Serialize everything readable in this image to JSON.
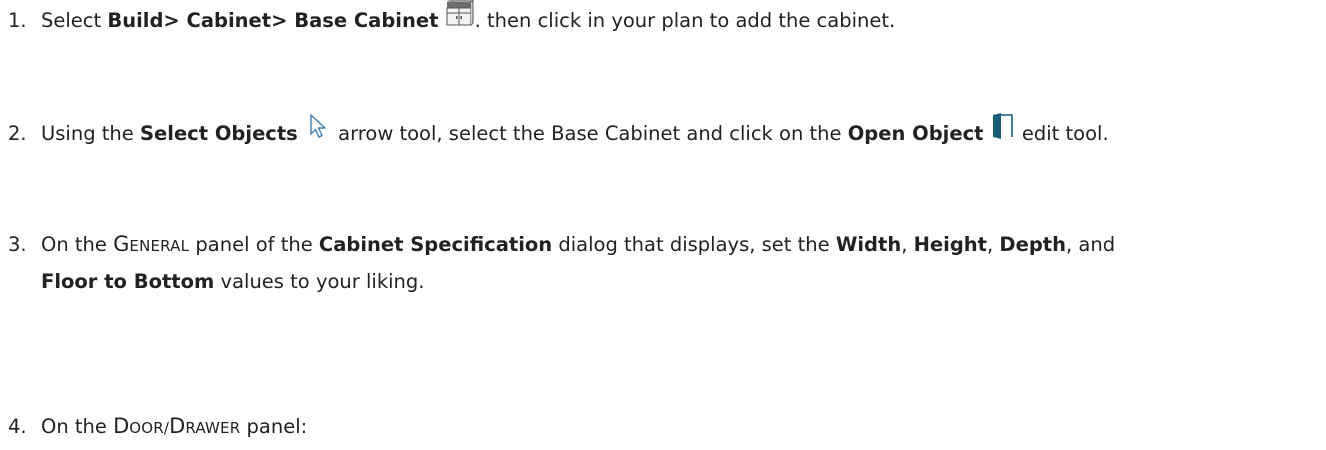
{
  "steps": [
    {
      "number": "1.",
      "parts": {
        "a": "Select ",
        "b_bold": "Build> Cabinet> Base Cabinet",
        "c": ". then click in your plan to add the cabinet."
      },
      "icon": "base-cabinet-icon"
    },
    {
      "number": "2.",
      "parts": {
        "a": "Using the ",
        "b_bold": "Select Objects",
        "c": " arrow tool, select the Base Cabinet and click on the ",
        "d_bold": "Open Object",
        "e": " edit tool."
      },
      "icons": [
        "select-arrow-icon",
        "open-object-icon"
      ]
    },
    {
      "number": "3.",
      "parts": {
        "a": "On the ",
        "panel_first": "G",
        "panel_rest": "eneral",
        "b": " panel of the ",
        "c_bold": "Cabinet Specification",
        "d": " dialog that displays, set the ",
        "width_bold": "Width",
        "sep1": ", ",
        "height_bold": "Height",
        "sep2": ", ",
        "depth_bold": "Depth",
        "sep3": ", and",
        "floor_bold": "Floor to Bottom",
        "e": " values to your liking."
      }
    },
    {
      "number": "4.",
      "parts": {
        "a": "On the ",
        "panel_first": "D",
        "panel_mid": "oor/",
        "panel_first2": "D",
        "panel_rest2": "rawer",
        "b": " panel:"
      }
    }
  ],
  "colors": {
    "text": "#222222",
    "open_object_icon": "#1a5f7a",
    "cabinet_icon_top": "#6d6d6d"
  }
}
